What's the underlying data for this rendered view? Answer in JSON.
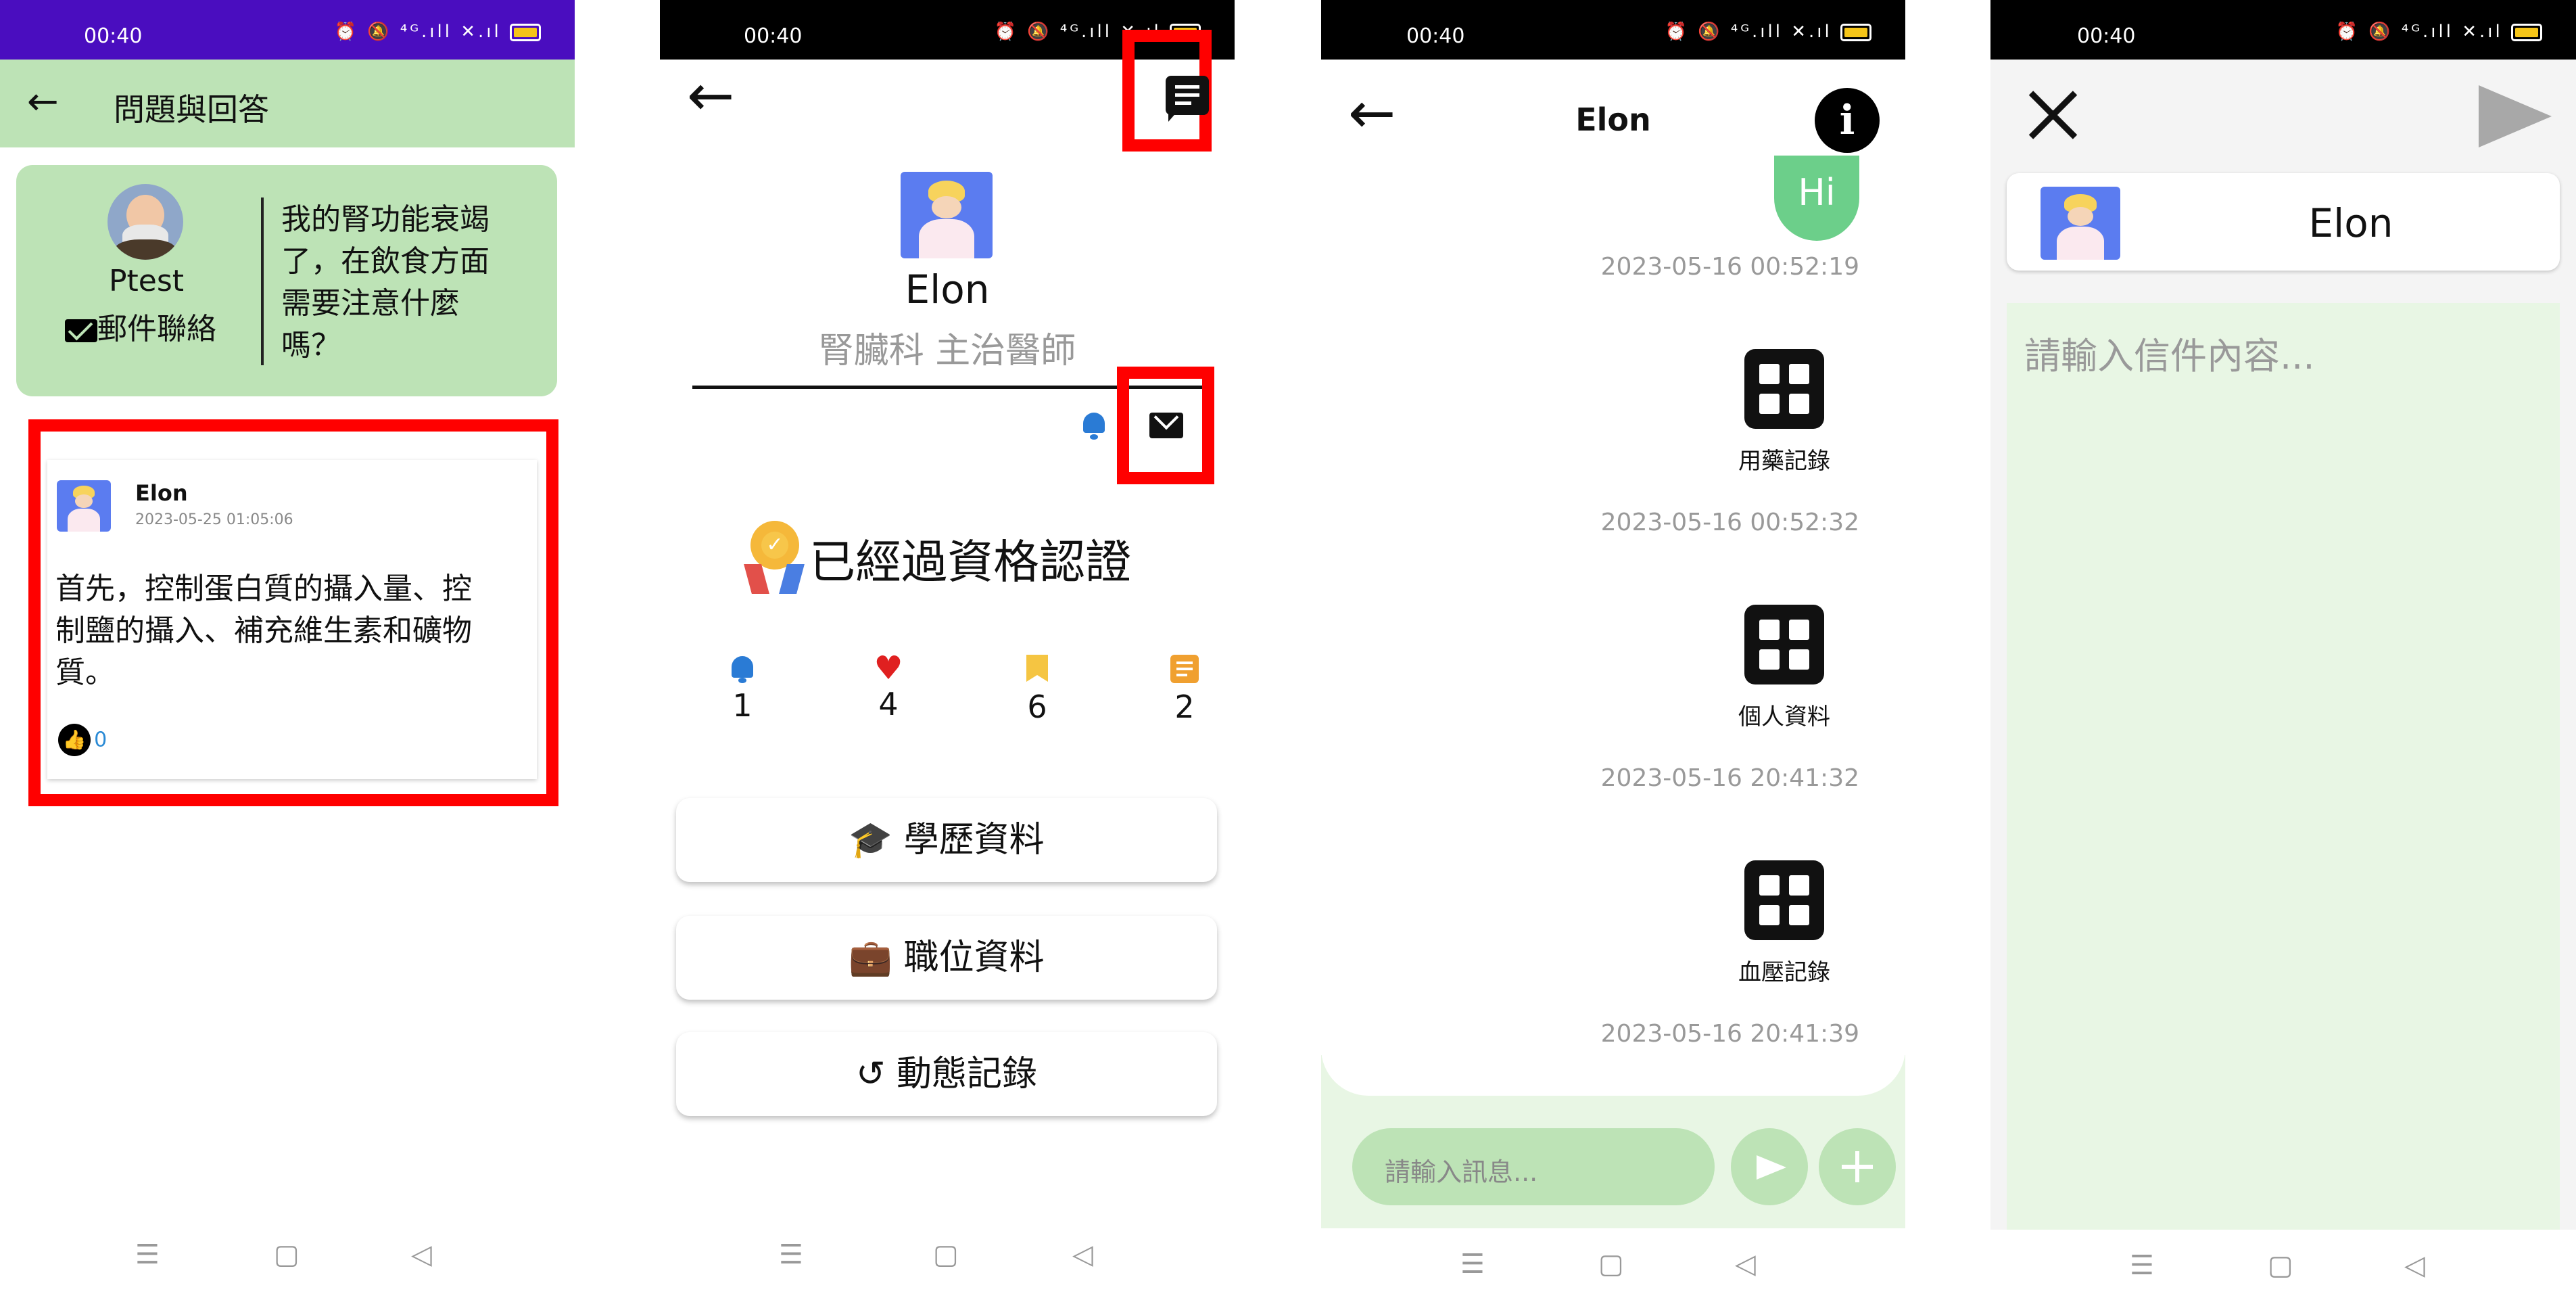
{
  "status_bar": {
    "time": "00:40",
    "icons": "⏰ 🔕 ⁴ᴳ.ıll ✕.ıl"
  },
  "system_nav": {
    "menu": "☰",
    "home": "▢",
    "back": "◁"
  },
  "panel1": {
    "header": {
      "title": "問題與回答",
      "back": "←"
    },
    "question": {
      "user": "Ptest",
      "contact": "郵件聯絡",
      "text_lines": [
        "我的腎功能衰竭",
        "了，在飲食方面",
        "需要注意什麼",
        "嗎？"
      ]
    },
    "answer": {
      "author": "Elon",
      "date": "2023-05-25 01:05:06",
      "text_lines": [
        "首先，控制蛋白質的攝入量、控",
        "制鹽的攝入、補充維生素和礦物",
        "質。"
      ],
      "likes": "0"
    }
  },
  "panel2": {
    "back": "←",
    "name": "Elon",
    "title": "腎臟科 主治醫師",
    "certified": "已經過資格認證",
    "stats": [
      {
        "icon": "bell-icon",
        "value": "1",
        "color": "#2a7bd5"
      },
      {
        "icon": "heart-icon",
        "value": "4",
        "color": "#e02020"
      },
      {
        "icon": "bookmark-icon",
        "value": "6",
        "color": "#f5c542"
      },
      {
        "icon": "note-icon",
        "value": "2",
        "color": "#f0a030"
      }
    ],
    "buttons": [
      "學歷資料",
      "職位資料",
      "動態記錄"
    ]
  },
  "panel3": {
    "back": "←",
    "title": "Elon",
    "messages": [
      {
        "type": "text",
        "text": "Hi",
        "time": "2023-05-16 00:52:19"
      },
      {
        "type": "card",
        "text": "用藥記錄",
        "time": "2023-05-16 00:52:32"
      },
      {
        "type": "card",
        "text": "個人資料",
        "time": "2023-05-16 20:41:32"
      },
      {
        "type": "card",
        "text": "血壓記錄",
        "time": "2023-05-16 20:41:39"
      }
    ],
    "input_placeholder": "請輸入訊息..."
  },
  "panel4": {
    "recipient": "Elon",
    "placeholder": "請輸入信件內容..."
  },
  "colors": {
    "accent_green": "#bde3b6",
    "purple_status": "#4a0dbf",
    "highlight_red": "#ff0000"
  }
}
